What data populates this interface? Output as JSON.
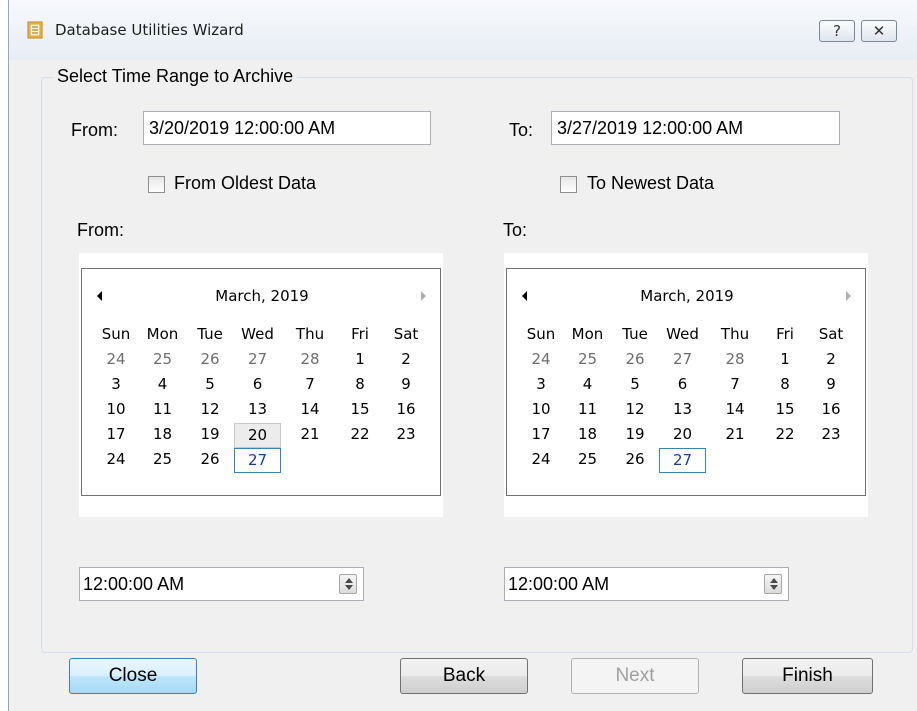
{
  "window": {
    "title": "Database Utilities Wizard",
    "help_button": "?",
    "close_button": "✕"
  },
  "group": {
    "title": "Select Time Range to Archive"
  },
  "range": {
    "from_label": "From:",
    "from_value": "3/20/2019 12:00:00 AM",
    "to_label": "To:",
    "to_value": "3/27/2019 12:00:00 AM",
    "from_oldest_label": "From Oldest Data",
    "from_oldest_checked": false,
    "to_newest_label": "To Newest Data",
    "to_newest_checked": false
  },
  "calendars": {
    "from_label": "From:",
    "to_label": "To:",
    "from": {
      "month_title": "March, 2019",
      "days_of_week": [
        "Sun",
        "Mon",
        "Tue",
        "Wed",
        "Thu",
        "Fri",
        "Sat"
      ],
      "weeks": [
        [
          "24",
          "25",
          "26",
          "27",
          "28",
          "1",
          "2"
        ],
        [
          "3",
          "4",
          "5",
          "6",
          "7",
          "8",
          "9"
        ],
        [
          "10",
          "11",
          "12",
          "13",
          "14",
          "15",
          "16"
        ],
        [
          "17",
          "18",
          "19",
          "20",
          "21",
          "22",
          "23"
        ],
        [
          "24",
          "25",
          "26",
          "27",
          "",
          "",
          ""
        ]
      ],
      "selected_day": "20",
      "today_day": "27"
    },
    "to": {
      "month_title": "March, 2019",
      "days_of_week": [
        "Sun",
        "Mon",
        "Tue",
        "Wed",
        "Thu",
        "Fri",
        "Sat"
      ],
      "weeks": [
        [
          "24",
          "25",
          "26",
          "27",
          "28",
          "1",
          "2"
        ],
        [
          "3",
          "4",
          "5",
          "6",
          "7",
          "8",
          "9"
        ],
        [
          "10",
          "11",
          "12",
          "13",
          "14",
          "15",
          "16"
        ],
        [
          "17",
          "18",
          "19",
          "20",
          "21",
          "22",
          "23"
        ],
        [
          "24",
          "25",
          "26",
          "27",
          "",
          "",
          ""
        ]
      ],
      "selected_day": "27",
      "today_day": "27"
    }
  },
  "times": {
    "from_time": "12:00:00 AM",
    "to_time": "12:00:00 AM"
  },
  "buttons": {
    "close": "Close",
    "back": "Back",
    "next": "Next",
    "finish": "Finish"
  },
  "colors": {
    "accent": "#3c7fb1",
    "window_bg": "#f0f0f0",
    "disabled_text": "#a0a0a0"
  }
}
